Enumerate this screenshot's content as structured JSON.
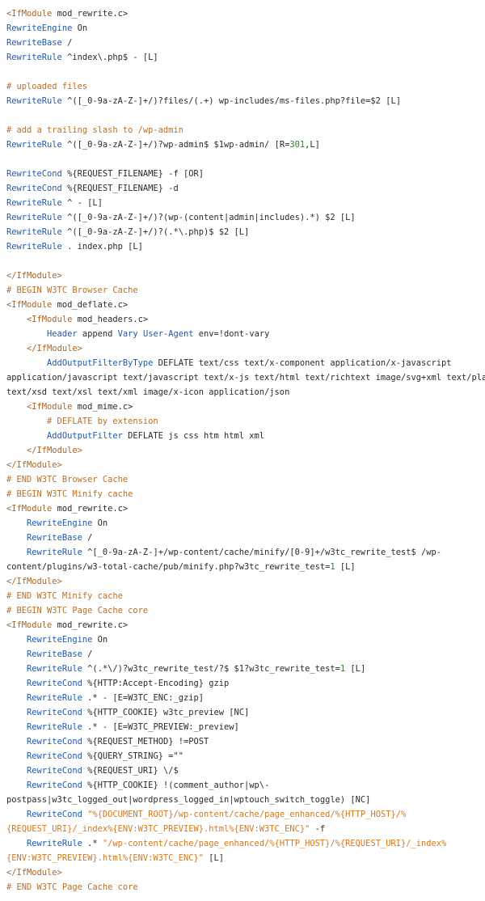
{
  "colors": {
    "background": "#ffffff",
    "text": "#2a2a2a",
    "tag": "#a3652c",
    "keyword": "#2258a8",
    "comment": "#b5702b",
    "string": "#d2781e",
    "number": "#2f7d2f"
  },
  "lines": [
    [
      [
        "tag",
        "<IfModule"
      ],
      [
        "t",
        " mod_rewrite.c>"
      ]
    ],
    [
      [
        "kw",
        "RewriteEngine"
      ],
      [
        "t",
        " On"
      ]
    ],
    [
      [
        "kw",
        "RewriteBase"
      ],
      [
        "t",
        " /"
      ]
    ],
    [
      [
        "kw",
        "RewriteRule"
      ],
      [
        "t",
        " ^index\\.php$ - [L]"
      ]
    ],
    [],
    [
      [
        "cm",
        "# uploaded files"
      ]
    ],
    [
      [
        "kw",
        "RewriteRule"
      ],
      [
        "t",
        " ^([_0-9a-zA-Z-]+/)?files/(.+) wp-includes/ms-files.php?file=$2 [L]"
      ]
    ],
    [],
    [
      [
        "cm",
        "# add a trailing slash to /wp-admin"
      ]
    ],
    [
      [
        "kw",
        "RewriteRule"
      ],
      [
        "t",
        " ^([_0-9a-zA-Z-]+/)?wp-admin$ $1wp-admin/ [R="
      ],
      [
        "num",
        "301"
      ],
      [
        "t",
        ",L]"
      ]
    ],
    [],
    [
      [
        "kw",
        "RewriteCond"
      ],
      [
        "t",
        " %{REQUEST_FILENAME} -f [OR]"
      ]
    ],
    [
      [
        "kw",
        "RewriteCond"
      ],
      [
        "t",
        " %{REQUEST_FILENAME} -d"
      ]
    ],
    [
      [
        "kw",
        "RewriteRule"
      ],
      [
        "t",
        " ^ - [L]"
      ]
    ],
    [
      [
        "kw",
        "RewriteRule"
      ],
      [
        "t",
        " ^([_0-9a-zA-Z-]+/)?(wp-(content|admin|includes).*) $2 [L]"
      ]
    ],
    [
      [
        "kw",
        "RewriteRule"
      ],
      [
        "t",
        " ^([_0-9a-zA-Z-]+/)?(.*\\.php)$ $2 [L]"
      ]
    ],
    [
      [
        "kw",
        "RewriteRule"
      ],
      [
        "t",
        " . index.php [L]"
      ]
    ],
    [],
    [
      [
        "tag",
        "</IfModule>"
      ]
    ],
    [
      [
        "cm",
        "# BEGIN W3TC Browser Cache"
      ]
    ],
    [
      [
        "tag",
        "<IfModule"
      ],
      [
        "t",
        " mod_deflate.c>"
      ]
    ],
    [
      [
        "t",
        "    "
      ],
      [
        "tag",
        "<IfModule"
      ],
      [
        "t",
        " mod_headers.c>"
      ]
    ],
    [
      [
        "t",
        "        "
      ],
      [
        "kw",
        "Header"
      ],
      [
        "t",
        " append "
      ],
      [
        "kw",
        "Vary"
      ],
      [
        "t",
        " "
      ],
      [
        "kw",
        "User-Agent"
      ],
      [
        "t",
        " env=!dont-vary"
      ]
    ],
    [
      [
        "t",
        "    "
      ],
      [
        "tag",
        "</IfModule>"
      ]
    ],
    [
      [
        "t",
        "        "
      ],
      [
        "kw",
        "AddOutputFilterByType"
      ],
      [
        "t",
        " DEFLATE text/css text/x-component application/x-javascript"
      ]
    ],
    [
      [
        "t",
        "application/javascript text/javascript text/x-js text/html text/richtext image/svg+xml text/plain"
      ]
    ],
    [
      [
        "t",
        "text/xsd text/xsl text/xml image/x-icon application/json"
      ]
    ],
    [
      [
        "t",
        "    "
      ],
      [
        "tag",
        "<IfModule"
      ],
      [
        "t",
        " mod_mime.c>"
      ]
    ],
    [
      [
        "t",
        "        "
      ],
      [
        "cm",
        "# DEFLATE by extension"
      ]
    ],
    [
      [
        "t",
        "        "
      ],
      [
        "kw",
        "AddOutputFilter"
      ],
      [
        "t",
        " DEFLATE js css htm html xml"
      ]
    ],
    [
      [
        "t",
        "    "
      ],
      [
        "tag",
        "</IfModule>"
      ]
    ],
    [
      [
        "tag",
        "</IfModule>"
      ]
    ],
    [
      [
        "cm",
        "# END W3TC Browser Cache"
      ]
    ],
    [
      [
        "cm",
        "# BEGIN W3TC Minify cache"
      ]
    ],
    [
      [
        "tag",
        "<IfModule"
      ],
      [
        "t",
        " mod_rewrite.c>"
      ]
    ],
    [
      [
        "t",
        "    "
      ],
      [
        "kw",
        "RewriteEngine"
      ],
      [
        "t",
        " On"
      ]
    ],
    [
      [
        "t",
        "    "
      ],
      [
        "kw",
        "RewriteBase"
      ],
      [
        "t",
        " /"
      ]
    ],
    [
      [
        "t",
        "    "
      ],
      [
        "kw",
        "RewriteRule"
      ],
      [
        "t",
        " ^[_0-9a-zA-Z-]+/wp-content/cache/minify/[0-9]+/w3tc_rewrite_test$ /wp-"
      ]
    ],
    [
      [
        "t",
        "content/plugins/w3-total-cache/pub/minify.php?w3tc_rewrite_test="
      ],
      [
        "num",
        "1"
      ],
      [
        "t",
        " [L]"
      ]
    ],
    [
      [
        "tag",
        "</IfModule>"
      ]
    ],
    [
      [
        "cm",
        "# END W3TC Minify cache"
      ]
    ],
    [
      [
        "cm",
        "# BEGIN W3TC Page Cache core"
      ]
    ],
    [
      [
        "tag",
        "<IfModule"
      ],
      [
        "t",
        " mod_rewrite.c>"
      ]
    ],
    [
      [
        "t",
        "    "
      ],
      [
        "kw",
        "RewriteEngine"
      ],
      [
        "t",
        " On"
      ]
    ],
    [
      [
        "t",
        "    "
      ],
      [
        "kw",
        "RewriteBase"
      ],
      [
        "t",
        " /"
      ]
    ],
    [
      [
        "t",
        "    "
      ],
      [
        "kw",
        "RewriteRule"
      ],
      [
        "t",
        " ^(.*\\/)?w3tc_rewrite_test/?$ $1?w3tc_rewrite_test="
      ],
      [
        "num",
        "1"
      ],
      [
        "t",
        " [L]"
      ]
    ],
    [
      [
        "t",
        "    "
      ],
      [
        "kw",
        "RewriteCond"
      ],
      [
        "t",
        " %{HTTP:Accept-Encoding} gzip"
      ]
    ],
    [
      [
        "t",
        "    "
      ],
      [
        "kw",
        "RewriteRule"
      ],
      [
        "t",
        " .* - [E=W3TC_ENC:_gzip]"
      ]
    ],
    [
      [
        "t",
        "    "
      ],
      [
        "kw",
        "RewriteCond"
      ],
      [
        "t",
        " %{HTTP_COOKIE} w3tc_preview [NC]"
      ]
    ],
    [
      [
        "t",
        "    "
      ],
      [
        "kw",
        "RewriteRule"
      ],
      [
        "t",
        " .* - [E=W3TC_PREVIEW:_preview]"
      ]
    ],
    [
      [
        "t",
        "    "
      ],
      [
        "kw",
        "RewriteCond"
      ],
      [
        "t",
        " %{REQUEST_METHOD} !=POST"
      ]
    ],
    [
      [
        "t",
        "    "
      ],
      [
        "kw",
        "RewriteCond"
      ],
      [
        "t",
        " %{QUERY_STRING} =\"\""
      ]
    ],
    [
      [
        "t",
        "    "
      ],
      [
        "kw",
        "RewriteCond"
      ],
      [
        "t",
        " %{REQUEST_URI} \\/$"
      ]
    ],
    [
      [
        "t",
        "    "
      ],
      [
        "kw",
        "RewriteCond"
      ],
      [
        "t",
        " %{HTTP_COOKIE} !(comment_author|wp\\-"
      ]
    ],
    [
      [
        "t",
        "postpass|w3tc_logged_out|wordpress_logged_in|wptouch_switch_toggle) [NC]"
      ]
    ],
    [
      [
        "t",
        "    "
      ],
      [
        "kw",
        "RewriteCond"
      ],
      [
        "t",
        " "
      ],
      [
        "str",
        "\"%{DOCUMENT_ROOT}/wp-content/cache/page_enhanced/%{HTTP_HOST}/%"
      ]
    ],
    [
      [
        "str",
        "{REQUEST_URI}/_index%{ENV:W3TC_PREVIEW}.html%{ENV:W3TC_ENC}\""
      ],
      [
        "t",
        " -f"
      ]
    ],
    [
      [
        "t",
        "    "
      ],
      [
        "kw",
        "RewriteRule"
      ],
      [
        "t",
        " .* "
      ],
      [
        "str",
        "\"/wp-content/cache/page_enhanced/%{HTTP_HOST}/%{REQUEST_URI}/_index%"
      ]
    ],
    [
      [
        "str",
        "{ENV:W3TC_PREVIEW}.html%{ENV:W3TC_ENC}\""
      ],
      [
        "t",
        " [L]"
      ]
    ],
    [
      [
        "tag",
        "</IfModule>"
      ]
    ],
    [
      [
        "cm",
        "# END W3TC Page Cache core"
      ]
    ]
  ]
}
